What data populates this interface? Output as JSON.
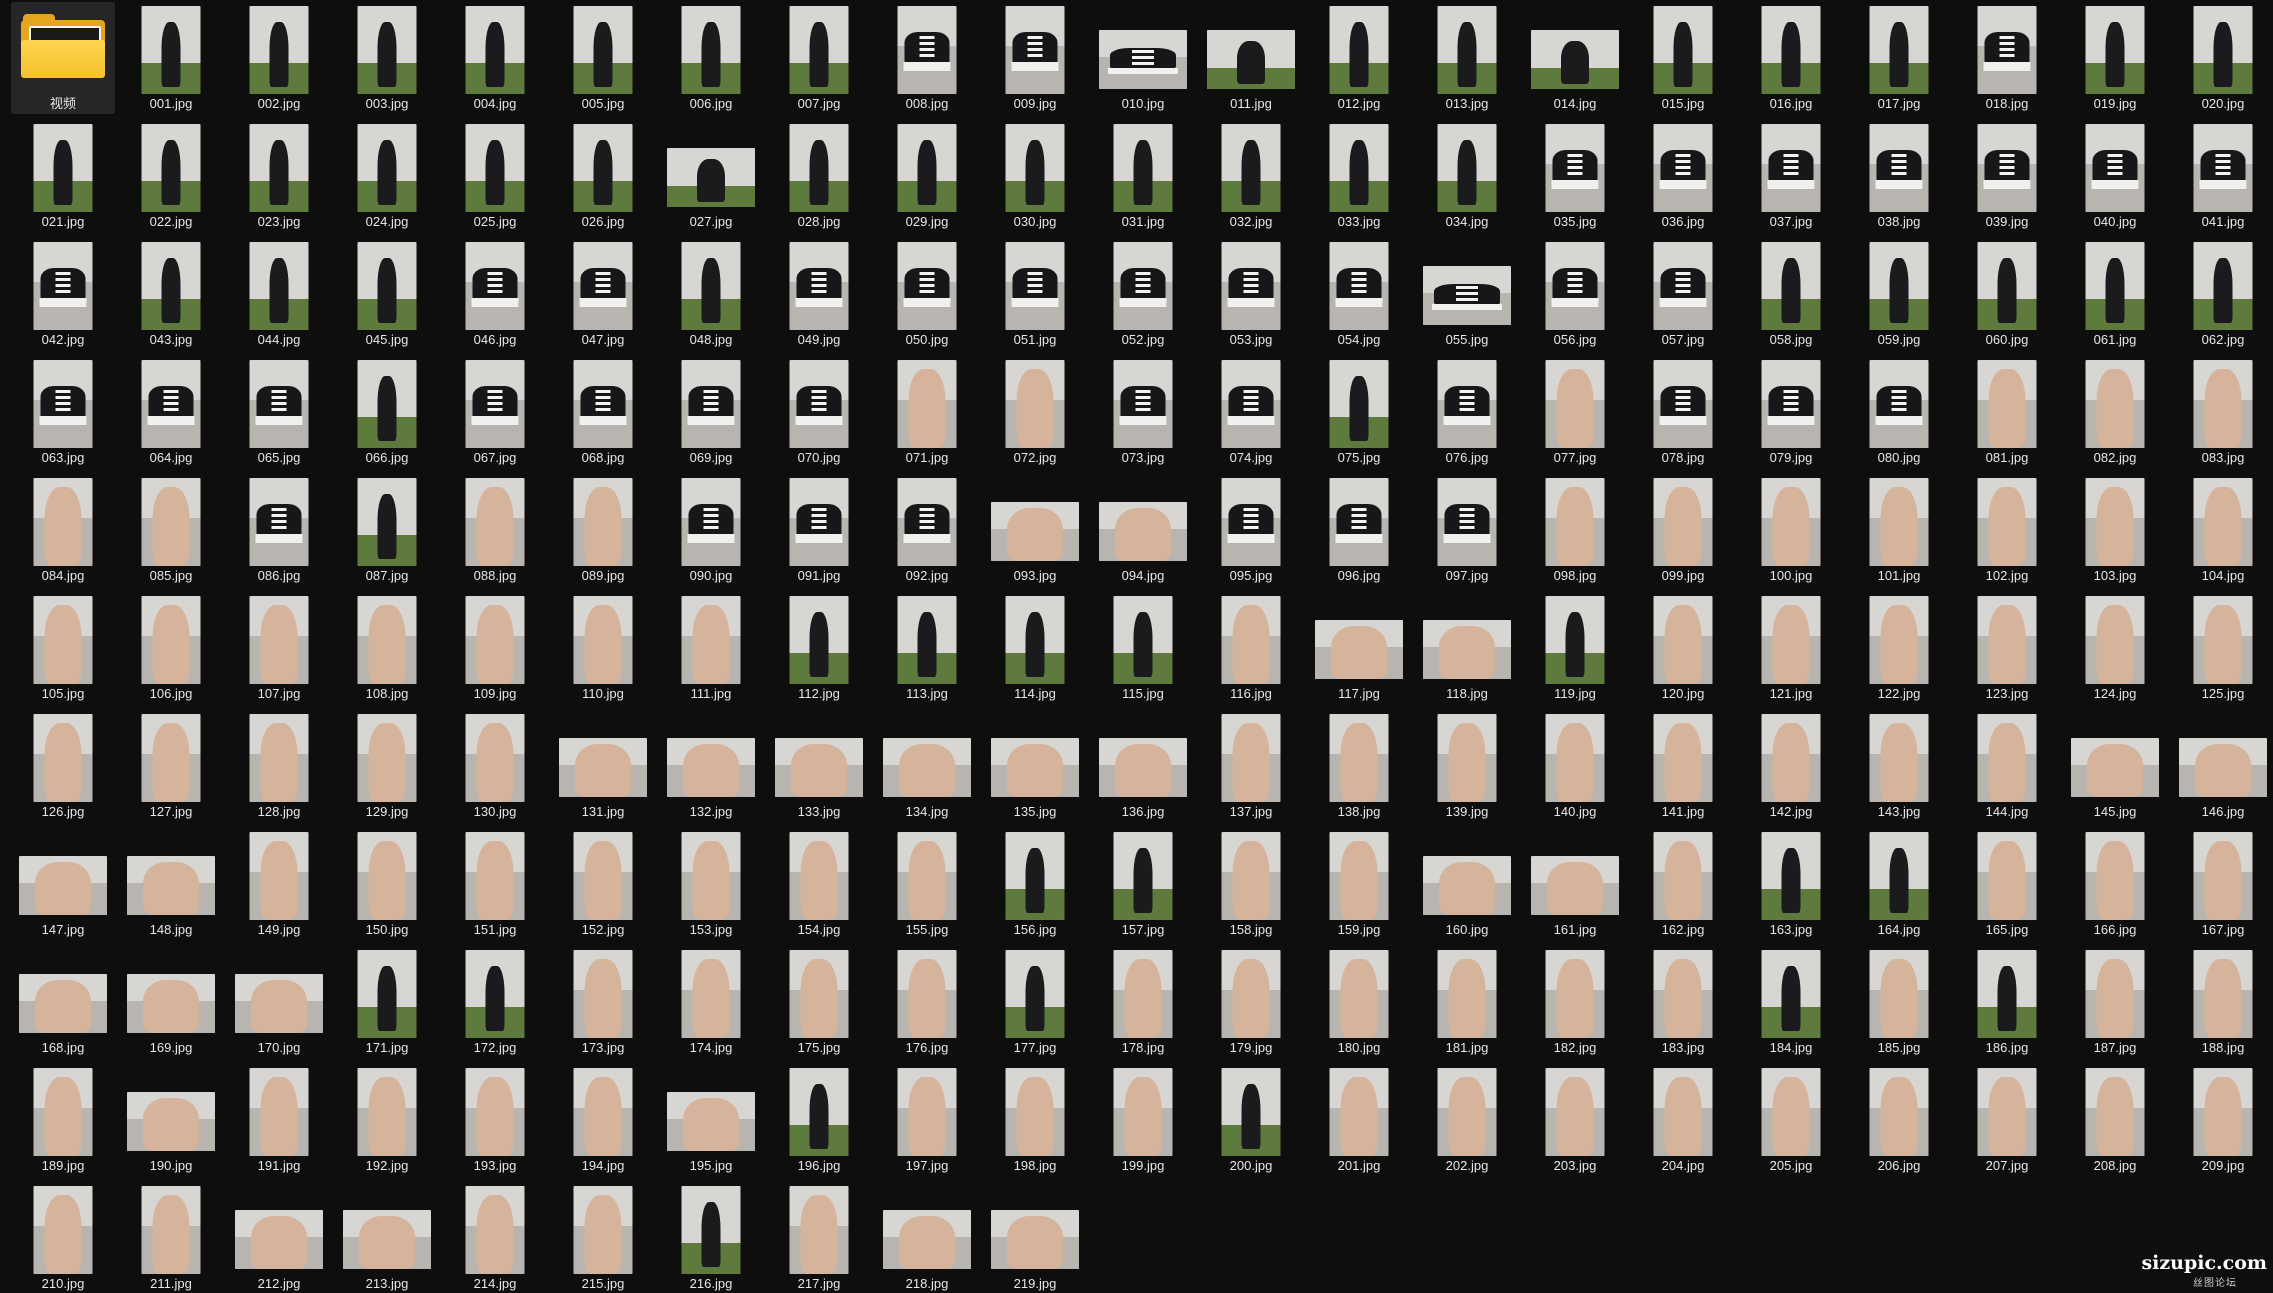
{
  "window": {
    "background": "#0e0e0f"
  },
  "folder": {
    "label": "视频",
    "icon": "folder-icon",
    "color": "#f4c12f"
  },
  "files": [
    {
      "name": "001.jpg",
      "kind": "portrait",
      "scene": "sofa"
    },
    {
      "name": "002.jpg",
      "kind": "portrait",
      "scene": "sofa"
    },
    {
      "name": "003.jpg",
      "kind": "portrait",
      "scene": "sofa"
    },
    {
      "name": "004.jpg",
      "kind": "portrait",
      "scene": "sofa"
    },
    {
      "name": "005.jpg",
      "kind": "portrait",
      "scene": "sofa"
    },
    {
      "name": "006.jpg",
      "kind": "portrait",
      "scene": "sofa"
    },
    {
      "name": "007.jpg",
      "kind": "portrait",
      "scene": "sofa"
    },
    {
      "name": "008.jpg",
      "kind": "portrait",
      "scene": "shoe"
    },
    {
      "name": "009.jpg",
      "kind": "portrait",
      "scene": "shoe"
    },
    {
      "name": "010.jpg",
      "kind": "landscape",
      "scene": "shoe"
    },
    {
      "name": "011.jpg",
      "kind": "landscape",
      "scene": "sofa"
    },
    {
      "name": "012.jpg",
      "kind": "portrait",
      "scene": "sofa"
    },
    {
      "name": "013.jpg",
      "kind": "portrait",
      "scene": "sofa"
    },
    {
      "name": "014.jpg",
      "kind": "landscape",
      "scene": "sofa"
    },
    {
      "name": "015.jpg",
      "kind": "portrait",
      "scene": "sofa"
    },
    {
      "name": "016.jpg",
      "kind": "portrait",
      "scene": "sofa"
    },
    {
      "name": "017.jpg",
      "kind": "portrait",
      "scene": "sofa"
    },
    {
      "name": "018.jpg",
      "kind": "portrait",
      "scene": "shoe"
    },
    {
      "name": "019.jpg",
      "kind": "portrait",
      "scene": "sofa"
    },
    {
      "name": "020.jpg",
      "kind": "portrait",
      "scene": "sofa"
    },
    {
      "name": "021.jpg",
      "kind": "portrait",
      "scene": "sofa"
    },
    {
      "name": "022.jpg",
      "kind": "portrait",
      "scene": "sofa"
    },
    {
      "name": "023.jpg",
      "kind": "portrait",
      "scene": "sofa"
    },
    {
      "name": "024.jpg",
      "kind": "portrait",
      "scene": "sofa"
    },
    {
      "name": "025.jpg",
      "kind": "portrait",
      "scene": "sofa"
    },
    {
      "name": "026.jpg",
      "kind": "portrait",
      "scene": "sofa"
    },
    {
      "name": "027.jpg",
      "kind": "landscape",
      "scene": "sofa"
    },
    {
      "name": "028.jpg",
      "kind": "portrait",
      "scene": "sofa"
    },
    {
      "name": "029.jpg",
      "kind": "portrait",
      "scene": "sofa"
    },
    {
      "name": "030.jpg",
      "kind": "portrait",
      "scene": "sofa"
    },
    {
      "name": "031.jpg",
      "kind": "portrait",
      "scene": "sofa"
    },
    {
      "name": "032.jpg",
      "kind": "portrait",
      "scene": "sofa"
    },
    {
      "name": "033.jpg",
      "kind": "portrait",
      "scene": "sofa"
    },
    {
      "name": "034.jpg",
      "kind": "portrait",
      "scene": "sofa"
    },
    {
      "name": "035.jpg",
      "kind": "portrait",
      "scene": "shoe"
    },
    {
      "name": "036.jpg",
      "kind": "portrait",
      "scene": "shoe"
    },
    {
      "name": "037.jpg",
      "kind": "portrait",
      "scene": "shoe"
    },
    {
      "name": "038.jpg",
      "kind": "portrait",
      "scene": "shoe"
    },
    {
      "name": "039.jpg",
      "kind": "portrait",
      "scene": "shoe"
    },
    {
      "name": "040.jpg",
      "kind": "portrait",
      "scene": "shoe"
    },
    {
      "name": "041.jpg",
      "kind": "portrait",
      "scene": "shoe"
    },
    {
      "name": "042.jpg",
      "kind": "portrait",
      "scene": "shoe"
    },
    {
      "name": "043.jpg",
      "kind": "portrait",
      "scene": "sofa"
    },
    {
      "name": "044.jpg",
      "kind": "portrait",
      "scene": "sofa"
    },
    {
      "name": "045.jpg",
      "kind": "portrait",
      "scene": "sofa"
    },
    {
      "name": "046.jpg",
      "kind": "portrait",
      "scene": "shoe"
    },
    {
      "name": "047.jpg",
      "kind": "portrait",
      "scene": "shoe"
    },
    {
      "name": "048.jpg",
      "kind": "portrait",
      "scene": "sofa"
    },
    {
      "name": "049.jpg",
      "kind": "portrait",
      "scene": "shoe"
    },
    {
      "name": "050.jpg",
      "kind": "portrait",
      "scene": "shoe"
    },
    {
      "name": "051.jpg",
      "kind": "portrait",
      "scene": "shoe"
    },
    {
      "name": "052.jpg",
      "kind": "portrait",
      "scene": "shoe"
    },
    {
      "name": "053.jpg",
      "kind": "portrait",
      "scene": "shoe"
    },
    {
      "name": "054.jpg",
      "kind": "portrait",
      "scene": "shoe"
    },
    {
      "name": "055.jpg",
      "kind": "landscape",
      "scene": "shoe"
    },
    {
      "name": "056.jpg",
      "kind": "portrait",
      "scene": "shoe"
    },
    {
      "name": "057.jpg",
      "kind": "portrait",
      "scene": "shoe"
    },
    {
      "name": "058.jpg",
      "kind": "portrait",
      "scene": "sofa"
    },
    {
      "name": "059.jpg",
      "kind": "portrait",
      "scene": "sofa"
    },
    {
      "name": "060.jpg",
      "kind": "portrait",
      "scene": "sofa"
    },
    {
      "name": "061.jpg",
      "kind": "portrait",
      "scene": "sofa"
    },
    {
      "name": "062.jpg",
      "kind": "portrait",
      "scene": "sofa"
    },
    {
      "name": "063.jpg",
      "kind": "portrait",
      "scene": "shoe"
    },
    {
      "name": "064.jpg",
      "kind": "portrait",
      "scene": "shoe"
    },
    {
      "name": "065.jpg",
      "kind": "portrait",
      "scene": "shoe"
    },
    {
      "name": "066.jpg",
      "kind": "portrait",
      "scene": "sofa"
    },
    {
      "name": "067.jpg",
      "kind": "portrait",
      "scene": "shoe"
    },
    {
      "name": "068.jpg",
      "kind": "portrait",
      "scene": "shoe"
    },
    {
      "name": "069.jpg",
      "kind": "portrait",
      "scene": "shoe"
    },
    {
      "name": "070.jpg",
      "kind": "portrait",
      "scene": "shoe"
    },
    {
      "name": "071.jpg",
      "kind": "portrait",
      "scene": "skin"
    },
    {
      "name": "072.jpg",
      "kind": "portrait",
      "scene": "skin"
    },
    {
      "name": "073.jpg",
      "kind": "portrait",
      "scene": "shoe"
    },
    {
      "name": "074.jpg",
      "kind": "portrait",
      "scene": "shoe"
    },
    {
      "name": "075.jpg",
      "kind": "portrait",
      "scene": "sofa"
    },
    {
      "name": "076.jpg",
      "kind": "portrait",
      "scene": "shoe"
    },
    {
      "name": "077.jpg",
      "kind": "portrait",
      "scene": "skin"
    },
    {
      "name": "078.jpg",
      "kind": "portrait",
      "scene": "shoe"
    },
    {
      "name": "079.jpg",
      "kind": "portrait",
      "scene": "shoe"
    },
    {
      "name": "080.jpg",
      "kind": "portrait",
      "scene": "shoe"
    },
    {
      "name": "081.jpg",
      "kind": "portrait",
      "scene": "skin"
    },
    {
      "name": "082.jpg",
      "kind": "portrait",
      "scene": "skin"
    },
    {
      "name": "083.jpg",
      "kind": "portrait",
      "scene": "skin"
    },
    {
      "name": "084.jpg",
      "kind": "portrait",
      "scene": "skin"
    },
    {
      "name": "085.jpg",
      "kind": "portrait",
      "scene": "skin"
    },
    {
      "name": "086.jpg",
      "kind": "portrait",
      "scene": "shoe"
    },
    {
      "name": "087.jpg",
      "kind": "portrait",
      "scene": "sofa"
    },
    {
      "name": "088.jpg",
      "kind": "portrait",
      "scene": "skin"
    },
    {
      "name": "089.jpg",
      "kind": "portrait",
      "scene": "skin"
    },
    {
      "name": "090.jpg",
      "kind": "portrait",
      "scene": "shoe"
    },
    {
      "name": "091.jpg",
      "kind": "portrait",
      "scene": "shoe"
    },
    {
      "name": "092.jpg",
      "kind": "portrait",
      "scene": "shoe"
    },
    {
      "name": "093.jpg",
      "kind": "landscape",
      "scene": "skin"
    },
    {
      "name": "094.jpg",
      "kind": "landscape",
      "scene": "skin"
    },
    {
      "name": "095.jpg",
      "kind": "portrait",
      "scene": "shoe"
    },
    {
      "name": "096.jpg",
      "kind": "portrait",
      "scene": "shoe"
    },
    {
      "name": "097.jpg",
      "kind": "portrait",
      "scene": "shoe"
    },
    {
      "name": "098.jpg",
      "kind": "portrait",
      "scene": "skin"
    },
    {
      "name": "099.jpg",
      "kind": "portrait",
      "scene": "skin"
    },
    {
      "name": "100.jpg",
      "kind": "portrait",
      "scene": "skin"
    },
    {
      "name": "101.jpg",
      "kind": "portrait",
      "scene": "skin"
    },
    {
      "name": "102.jpg",
      "kind": "portrait",
      "scene": "skin"
    },
    {
      "name": "103.jpg",
      "kind": "portrait",
      "scene": "skin"
    },
    {
      "name": "104.jpg",
      "kind": "portrait",
      "scene": "skin"
    },
    {
      "name": "105.jpg",
      "kind": "portrait",
      "scene": "skin"
    },
    {
      "name": "106.jpg",
      "kind": "portrait",
      "scene": "skin"
    },
    {
      "name": "107.jpg",
      "kind": "portrait",
      "scene": "skin"
    },
    {
      "name": "108.jpg",
      "kind": "portrait",
      "scene": "skin"
    },
    {
      "name": "109.jpg",
      "kind": "portrait",
      "scene": "skin"
    },
    {
      "name": "110.jpg",
      "kind": "portrait",
      "scene": "skin"
    },
    {
      "name": "111.jpg",
      "kind": "portrait",
      "scene": "skin"
    },
    {
      "name": "112.jpg",
      "kind": "portrait",
      "scene": "sofa"
    },
    {
      "name": "113.jpg",
      "kind": "portrait",
      "scene": "sofa"
    },
    {
      "name": "114.jpg",
      "kind": "portrait",
      "scene": "sofa"
    },
    {
      "name": "115.jpg",
      "kind": "portrait",
      "scene": "sofa"
    },
    {
      "name": "116.jpg",
      "kind": "portrait",
      "scene": "skin"
    },
    {
      "name": "117.jpg",
      "kind": "landscape",
      "scene": "skin"
    },
    {
      "name": "118.jpg",
      "kind": "landscape",
      "scene": "skin"
    },
    {
      "name": "119.jpg",
      "kind": "portrait",
      "scene": "sofa"
    },
    {
      "name": "120.jpg",
      "kind": "portrait",
      "scene": "skin"
    },
    {
      "name": "121.jpg",
      "kind": "portrait",
      "scene": "skin"
    },
    {
      "name": "122.jpg",
      "kind": "portrait",
      "scene": "skin"
    },
    {
      "name": "123.jpg",
      "kind": "portrait",
      "scene": "skin"
    },
    {
      "name": "124.jpg",
      "kind": "portrait",
      "scene": "skin"
    },
    {
      "name": "125.jpg",
      "kind": "portrait",
      "scene": "skin"
    },
    {
      "name": "126.jpg",
      "kind": "portrait",
      "scene": "skin"
    },
    {
      "name": "127.jpg",
      "kind": "portrait",
      "scene": "skin"
    },
    {
      "name": "128.jpg",
      "kind": "portrait",
      "scene": "skin"
    },
    {
      "name": "129.jpg",
      "kind": "portrait",
      "scene": "skin"
    },
    {
      "name": "130.jpg",
      "kind": "portrait",
      "scene": "skin"
    },
    {
      "name": "131.jpg",
      "kind": "landscape",
      "scene": "skin"
    },
    {
      "name": "132.jpg",
      "kind": "landscape",
      "scene": "skin"
    },
    {
      "name": "133.jpg",
      "kind": "landscape",
      "scene": "skin"
    },
    {
      "name": "134.jpg",
      "kind": "landscape",
      "scene": "skin"
    },
    {
      "name": "135.jpg",
      "kind": "landscape",
      "scene": "skin"
    },
    {
      "name": "136.jpg",
      "kind": "landscape",
      "scene": "skin"
    },
    {
      "name": "137.jpg",
      "kind": "portrait",
      "scene": "skin"
    },
    {
      "name": "138.jpg",
      "kind": "portrait",
      "scene": "skin"
    },
    {
      "name": "139.jpg",
      "kind": "portrait",
      "scene": "skin"
    },
    {
      "name": "140.jpg",
      "kind": "portrait",
      "scene": "skin"
    },
    {
      "name": "141.jpg",
      "kind": "portrait",
      "scene": "skin"
    },
    {
      "name": "142.jpg",
      "kind": "portrait",
      "scene": "skin"
    },
    {
      "name": "143.jpg",
      "kind": "portrait",
      "scene": "skin"
    },
    {
      "name": "144.jpg",
      "kind": "portrait",
      "scene": "skin"
    },
    {
      "name": "145.jpg",
      "kind": "landscape",
      "scene": "skin"
    },
    {
      "name": "146.jpg",
      "kind": "landscape",
      "scene": "skin"
    },
    {
      "name": "147.jpg",
      "kind": "landscape",
      "scene": "skin"
    },
    {
      "name": "148.jpg",
      "kind": "landscape",
      "scene": "skin"
    },
    {
      "name": "149.jpg",
      "kind": "portrait",
      "scene": "skin"
    },
    {
      "name": "150.jpg",
      "kind": "portrait",
      "scene": "skin"
    },
    {
      "name": "151.jpg",
      "kind": "portrait",
      "scene": "skin"
    },
    {
      "name": "152.jpg",
      "kind": "portrait",
      "scene": "skin"
    },
    {
      "name": "153.jpg",
      "kind": "portrait",
      "scene": "skin"
    },
    {
      "name": "154.jpg",
      "kind": "portrait",
      "scene": "skin"
    },
    {
      "name": "155.jpg",
      "kind": "portrait",
      "scene": "skin"
    },
    {
      "name": "156.jpg",
      "kind": "portrait",
      "scene": "sofa"
    },
    {
      "name": "157.jpg",
      "kind": "portrait",
      "scene": "sofa"
    },
    {
      "name": "158.jpg",
      "kind": "portrait",
      "scene": "skin"
    },
    {
      "name": "159.jpg",
      "kind": "portrait",
      "scene": "skin"
    },
    {
      "name": "160.jpg",
      "kind": "landscape",
      "scene": "skin"
    },
    {
      "name": "161.jpg",
      "kind": "landscape",
      "scene": "skin"
    },
    {
      "name": "162.jpg",
      "kind": "portrait",
      "scene": "skin"
    },
    {
      "name": "163.jpg",
      "kind": "portrait",
      "scene": "sofa"
    },
    {
      "name": "164.jpg",
      "kind": "portrait",
      "scene": "sofa"
    },
    {
      "name": "165.jpg",
      "kind": "portrait",
      "scene": "skin"
    },
    {
      "name": "166.jpg",
      "kind": "portrait",
      "scene": "skin"
    },
    {
      "name": "167.jpg",
      "kind": "portrait",
      "scene": "skin"
    },
    {
      "name": "168.jpg",
      "kind": "landscape",
      "scene": "skin"
    },
    {
      "name": "169.jpg",
      "kind": "landscape",
      "scene": "skin"
    },
    {
      "name": "170.jpg",
      "kind": "landscape",
      "scene": "skin"
    },
    {
      "name": "171.jpg",
      "kind": "portrait",
      "scene": "sofa"
    },
    {
      "name": "172.jpg",
      "kind": "portrait",
      "scene": "sofa"
    },
    {
      "name": "173.jpg",
      "kind": "portrait",
      "scene": "skin"
    },
    {
      "name": "174.jpg",
      "kind": "portrait",
      "scene": "skin"
    },
    {
      "name": "175.jpg",
      "kind": "portrait",
      "scene": "skin"
    },
    {
      "name": "176.jpg",
      "kind": "portrait",
      "scene": "skin"
    },
    {
      "name": "177.jpg",
      "kind": "portrait",
      "scene": "sofa"
    },
    {
      "name": "178.jpg",
      "kind": "portrait",
      "scene": "skin"
    },
    {
      "name": "179.jpg",
      "kind": "portrait",
      "scene": "skin"
    },
    {
      "name": "180.jpg",
      "kind": "portrait",
      "scene": "skin"
    },
    {
      "name": "181.jpg",
      "kind": "portrait",
      "scene": "skin"
    },
    {
      "name": "182.jpg",
      "kind": "portrait",
      "scene": "skin"
    },
    {
      "name": "183.jpg",
      "kind": "portrait",
      "scene": "skin"
    },
    {
      "name": "184.jpg",
      "kind": "portrait",
      "scene": "sofa"
    },
    {
      "name": "185.jpg",
      "kind": "portrait",
      "scene": "skin"
    },
    {
      "name": "186.jpg",
      "kind": "portrait",
      "scene": "sofa"
    },
    {
      "name": "187.jpg",
      "kind": "portrait",
      "scene": "skin"
    },
    {
      "name": "188.jpg",
      "kind": "portrait",
      "scene": "skin"
    },
    {
      "name": "189.jpg",
      "kind": "portrait",
      "scene": "skin"
    },
    {
      "name": "190.jpg",
      "kind": "landscape",
      "scene": "skin"
    },
    {
      "name": "191.jpg",
      "kind": "portrait",
      "scene": "skin"
    },
    {
      "name": "192.jpg",
      "kind": "portrait",
      "scene": "skin"
    },
    {
      "name": "193.jpg",
      "kind": "portrait",
      "scene": "skin"
    },
    {
      "name": "194.jpg",
      "kind": "portrait",
      "scene": "skin"
    },
    {
      "name": "195.jpg",
      "kind": "landscape",
      "scene": "skin"
    },
    {
      "name": "196.jpg",
      "kind": "portrait",
      "scene": "sofa"
    },
    {
      "name": "197.jpg",
      "kind": "portrait",
      "scene": "skin"
    },
    {
      "name": "198.jpg",
      "kind": "portrait",
      "scene": "skin"
    },
    {
      "name": "199.jpg",
      "kind": "portrait",
      "scene": "skin"
    },
    {
      "name": "200.jpg",
      "kind": "portrait",
      "scene": "sofa"
    },
    {
      "name": "201.jpg",
      "kind": "portrait",
      "scene": "skin"
    },
    {
      "name": "202.jpg",
      "kind": "portrait",
      "scene": "skin"
    },
    {
      "name": "203.jpg",
      "kind": "portrait",
      "scene": "skin"
    },
    {
      "name": "204.jpg",
      "kind": "portrait",
      "scene": "skin"
    },
    {
      "name": "205.jpg",
      "kind": "portrait",
      "scene": "skin"
    },
    {
      "name": "206.jpg",
      "kind": "portrait",
      "scene": "skin"
    },
    {
      "name": "207.jpg",
      "kind": "portrait",
      "scene": "skin"
    },
    {
      "name": "208.jpg",
      "kind": "portrait",
      "scene": "skin"
    },
    {
      "name": "209.jpg",
      "kind": "portrait",
      "scene": "skin"
    },
    {
      "name": "210.jpg",
      "kind": "portrait",
      "scene": "skin"
    },
    {
      "name": "211.jpg",
      "kind": "portrait",
      "scene": "skin"
    },
    {
      "name": "212.jpg",
      "kind": "landscape",
      "scene": "skin"
    },
    {
      "name": "213.jpg",
      "kind": "landscape",
      "scene": "skin"
    },
    {
      "name": "214.jpg",
      "kind": "portrait",
      "scene": "skin"
    },
    {
      "name": "215.jpg",
      "kind": "portrait",
      "scene": "skin"
    },
    {
      "name": "216.jpg",
      "kind": "portrait",
      "scene": "sofa"
    },
    {
      "name": "217.jpg",
      "kind": "portrait",
      "scene": "skin"
    },
    {
      "name": "218.jpg",
      "kind": "landscape",
      "scene": "skin"
    },
    {
      "name": "219.jpg",
      "kind": "landscape",
      "scene": "skin"
    }
  ],
  "watermark": {
    "text": "sizupic.com",
    "subtext": "丝图论坛"
  }
}
